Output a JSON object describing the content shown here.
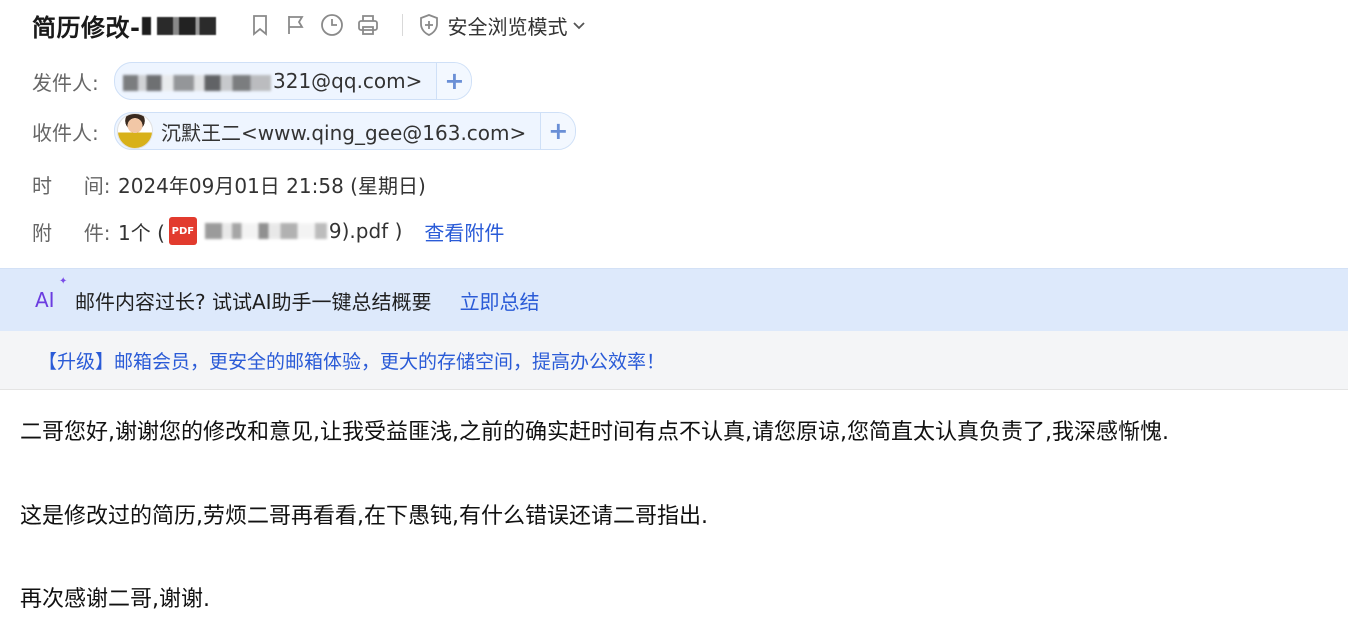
{
  "header": {
    "subject": "简历修改-",
    "secure_mode_label": "安全浏览模式"
  },
  "from": {
    "label": "发件人:",
    "address": "321@qq.com>"
  },
  "to": {
    "label": "收件人:",
    "name": "沉默王二<www.qing_gee@163.com>"
  },
  "time": {
    "label": "时     间:",
    "value": "2024年09月01日 21:58 (星期日)"
  },
  "attachment": {
    "label": "附     件:",
    "count": "1个 (",
    "pdf_badge": "PDF",
    "filename_tail": "9).pdf )",
    "view_label": "查看附件"
  },
  "ai_bar": {
    "logo": "AI",
    "spark": "✦",
    "text": "邮件内容过长? 试试AI助手一键总结概要",
    "action": "立即总结"
  },
  "promo": {
    "text": "【升级】邮箱会员，更安全的邮箱体验，更大的存储空间，提高办公效率！"
  },
  "body": {
    "paragraphs": [
      "二哥您好,谢谢您的修改和意见,让我受益匪浅,之前的确实赶时间有点不认真,请您原谅,您简直太认真负责了,我深感惭愧.",
      "这是修改过的简历,劳烦二哥再看看,在下愚钝,有什么错误还请二哥指出.",
      "再次感谢二哥,谢谢."
    ]
  },
  "icons": [
    "bookmark-icon",
    "flag-icon",
    "clock-icon",
    "print-icon",
    "shield-icon",
    "chevron-down-icon",
    "plus-icon",
    "pdf-icon"
  ]
}
